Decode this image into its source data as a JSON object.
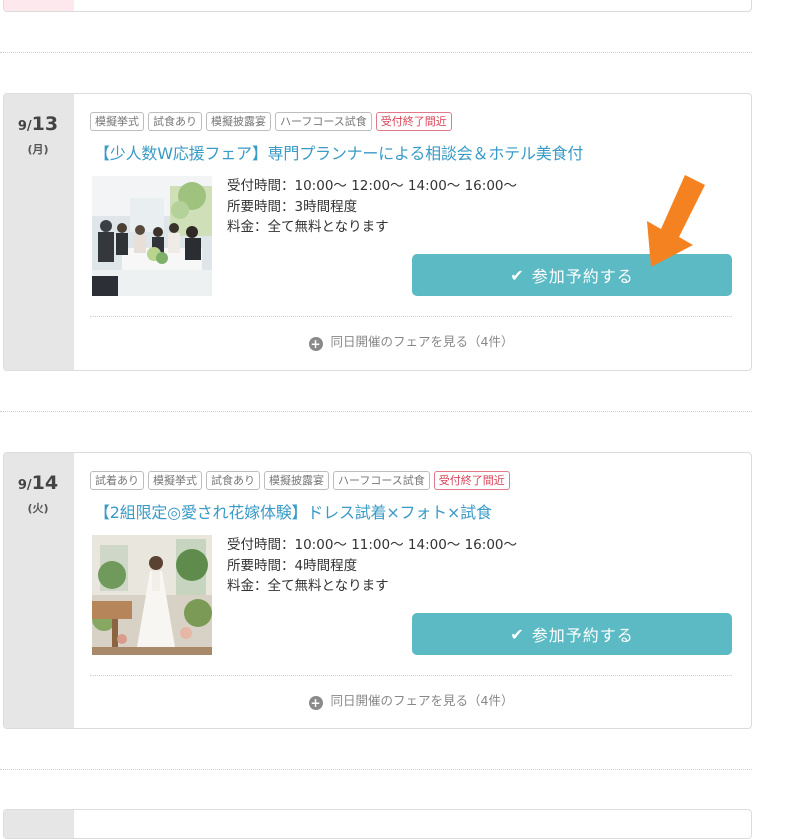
{
  "fairs": [
    {
      "date": {
        "month": "9/",
        "day": "13",
        "weekday": "(月)"
      },
      "tags": [
        {
          "label": "模擬挙式",
          "alert": false
        },
        {
          "label": "試食あり",
          "alert": false
        },
        {
          "label": "模擬披露宴",
          "alert": false
        },
        {
          "label": "ハーフコース試食",
          "alert": false
        },
        {
          "label": "受付終了間近",
          "alert": true
        }
      ],
      "title": "【少人数W応援フェア】専門プランナーによる相談会＆ホテル美食付",
      "reception": "受付時間：10:00～ 12:00～ 14:00～ 16:00～",
      "duration": "所要時間：3時間程度",
      "fee": "料金：全て無料となります",
      "reserve_label": "参加予約する",
      "more_label": "同日開催のフェアを見る（4件）",
      "photo_icon": "banquet-photo"
    },
    {
      "date": {
        "month": "9/",
        "day": "14",
        "weekday": "(火)"
      },
      "tags": [
        {
          "label": "試着あり",
          "alert": false
        },
        {
          "label": "模擬挙式",
          "alert": false
        },
        {
          "label": "試食あり",
          "alert": false
        },
        {
          "label": "模擬披露宴",
          "alert": false
        },
        {
          "label": "ハーフコース試食",
          "alert": false
        },
        {
          "label": "受付終了間近",
          "alert": true
        }
      ],
      "title": "【2組限定◎愛され花嫁体験】ドレス試着×フォト×試食",
      "reception": "受付時間：10:00～ 11:00～ 14:00～ 16:00～",
      "duration": "所要時間：4時間程度",
      "fee": "料金：全て無料となります",
      "reserve_label": "参加予約する",
      "more_label": "同日開催のフェアを見る（4件）",
      "photo_icon": "bride-photo"
    }
  ],
  "colors": {
    "accent_button": "#5bbac4",
    "title_link": "#3a9bc7",
    "alert_tag": "#d9455a",
    "arrow": "#f58220"
  }
}
